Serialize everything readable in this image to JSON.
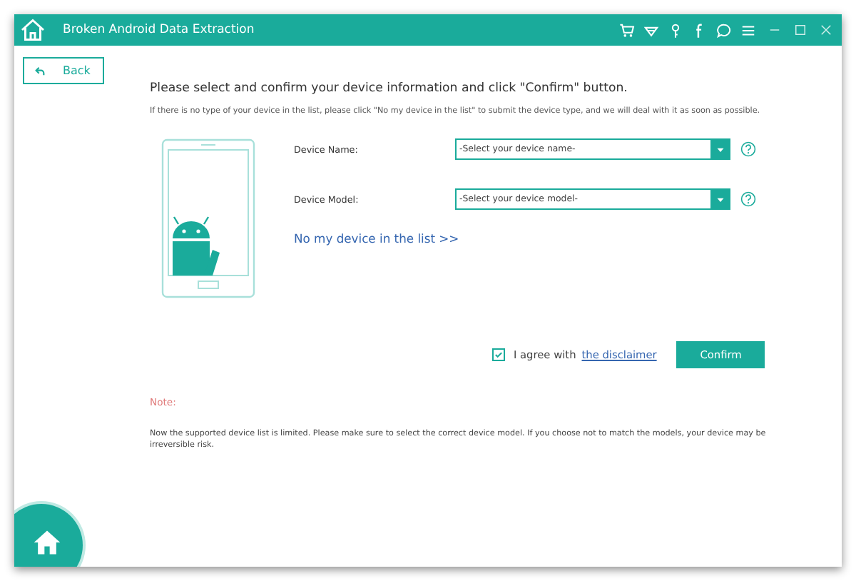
{
  "window": {
    "title": "Broken Android Data Extraction"
  },
  "back_button": {
    "label": "Back"
  },
  "heading": "Please select and confirm your device information and click \"Confirm\" button.",
  "instructions": "If there is no type of your device in the list, please click \"No my device in the list\" to submit the device type, and we will deal with it as soon as possible.",
  "fields": [
    {
      "label": "Device Name:",
      "placeholder": "-Select your device name-"
    },
    {
      "label": "Device Model:",
      "placeholder": "-Select your device model-"
    }
  ],
  "no_device_link": "No my device in the list >>",
  "agree": {
    "checked": true,
    "label": "I agree with",
    "link": "the disclaimer"
  },
  "confirm_button": "Confirm",
  "note": {
    "title": "Note:",
    "text": "Now the supported device list is limited. Please make sure to select the correct device model. If you choose not to match the models, your device may be irreversible risk."
  }
}
